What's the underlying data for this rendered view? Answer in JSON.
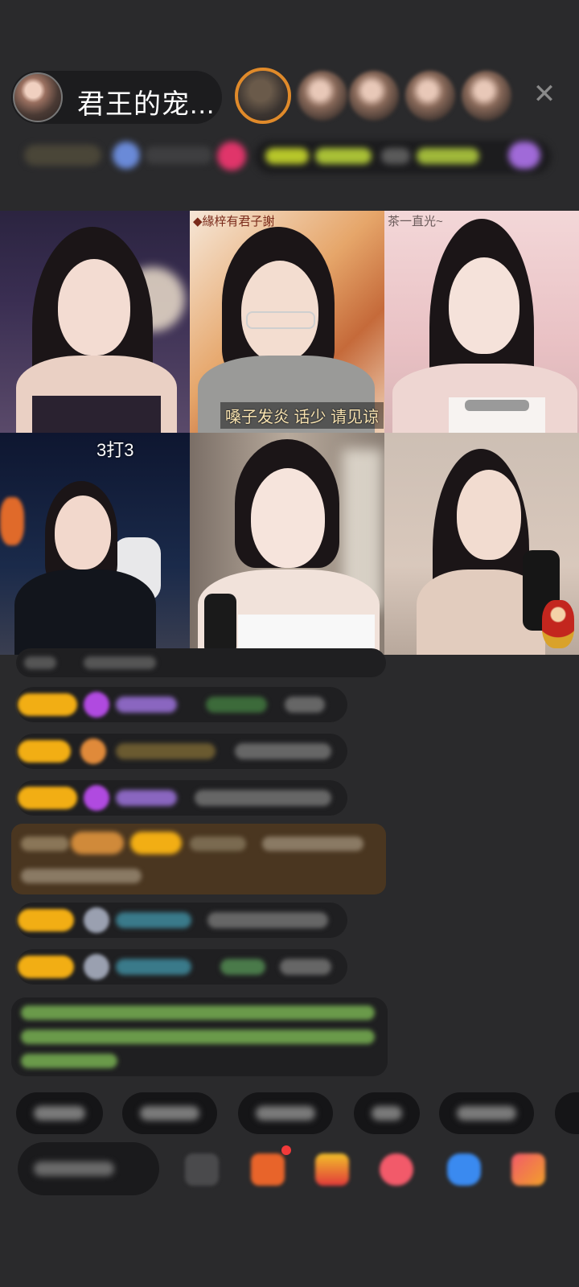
{
  "header": {
    "host_name": "君王的宠...",
    "close_icon": "close-icon"
  },
  "video_grid": {
    "cell_1": {
      "label": ""
    },
    "cell_2": {
      "top_label": "◆緣梓有君子謝",
      "caption": "嗓子发炎 话少 请见谅"
    },
    "cell_3": {
      "top_label": "茶一直光~"
    },
    "cell_4": {
      "top_label": "3打3"
    },
    "cell_5": {
      "label": ""
    },
    "cell_6": {
      "label": ""
    }
  },
  "colors": {
    "background": "#2a2a2c",
    "badge": "#f2ae14",
    "accent_orange": "#e08a2a",
    "gift_card": "#4a3620"
  }
}
